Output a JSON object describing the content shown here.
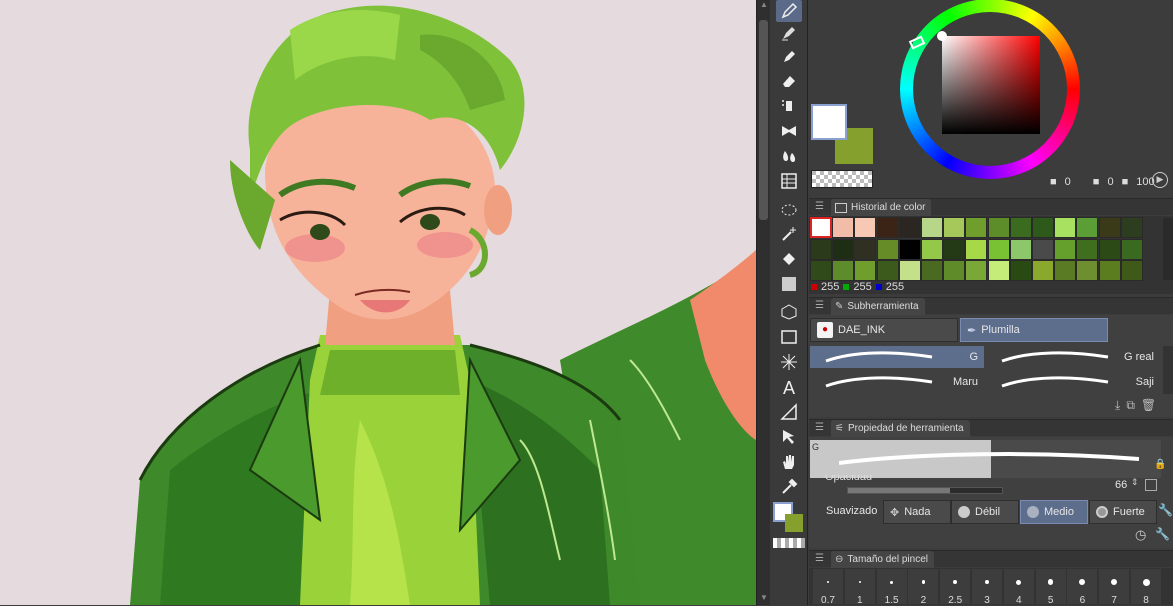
{
  "canvas": {
    "background": "#e5dadd",
    "content": "illustration-of-man-with-green-curly-hair-in-green-jacket"
  },
  "colors": {
    "main": "#ffffff",
    "sub": "#86a02d",
    "transparent": "checker"
  },
  "color_wheel": {
    "opacity_a": "0",
    "opacity_b": "0",
    "opacity_c": "100"
  },
  "color_history": {
    "title": "Historial de color",
    "rows": [
      [
        "#ffffff",
        "#f1bca8",
        "#f7c8b4",
        "#3b2416",
        "#2b2621",
        "#b8d68a",
        "#a6c85b",
        "#6f9e2c",
        "#5d8d29",
        "#3b6b1f",
        "#2d5a1a",
        "#a8e060",
        "#5b9e35",
        "#3a3a18",
        "#2d3d1f"
      ],
      [
        "#2a3a1a",
        "#1e2e14",
        "#2f2f22",
        "#668c28",
        "#000000",
        "#93c848",
        "#243a16",
        "#a7d848",
        "#78c234",
        "#8cc86b",
        "#4a4a4a",
        "#66a02c",
        "#3f6e1e",
        "#2b4a16",
        "#3a6a1f"
      ],
      [
        "#314a1a",
        "#5e8c2c",
        "#6f9e2c",
        "#3b5a1c",
        "#c5e08a",
        "#4a6a22",
        "#5f8c28",
        "#7aa838",
        "#c5ec78",
        "#2a4a14",
        "#8aa82c",
        "#5a7a24",
        "#6e8e30",
        "#5c7c20",
        "#3f5a18"
      ]
    ],
    "rgb": {
      "r": "255",
      "g": "255",
      "b": "255"
    }
  },
  "subtool": {
    "title": "Subherramienta",
    "groups": [
      {
        "label": "DAE_INK"
      },
      {
        "label": "Plumilla"
      }
    ],
    "brushes": [
      {
        "label": "G"
      },
      {
        "label": "G real"
      },
      {
        "label": "Maru"
      },
      {
        "label": "Saji"
      }
    ]
  },
  "tool_property": {
    "title": "Propiedad de herramienta",
    "brush_name": "G",
    "opacity_label": "Opacidad",
    "opacity_value": "66",
    "opacity_fraction": 0.66,
    "smoothing_label": "Suavizado",
    "smoothing_options": [
      {
        "label": "Nada"
      },
      {
        "label": "Débil"
      },
      {
        "label": "Medio"
      },
      {
        "label": "Fuerte"
      }
    ],
    "smoothing_selected": "Medio"
  },
  "brush_size": {
    "title": "Tamaño del pincel",
    "sizes": [
      "0.7",
      "1",
      "1.5",
      "2",
      "2.5",
      "3",
      "4",
      "5",
      "6",
      "7",
      "8"
    ]
  },
  "toolbar_icons": [
    "pen-icon",
    "pen-alt-icon",
    "marker-icon",
    "eraser-icon",
    "airbrush-icon",
    "decoration-icon",
    "blend-icon",
    "figure-icon",
    "selection-icon",
    "auto-select-icon",
    "fill-icon",
    "gradient-icon",
    "3d-icon",
    "rectangle-icon",
    "burst-icon",
    "text-icon",
    "ruler-icon",
    "object-icon",
    "hand-icon",
    "eyedropper-icon"
  ]
}
